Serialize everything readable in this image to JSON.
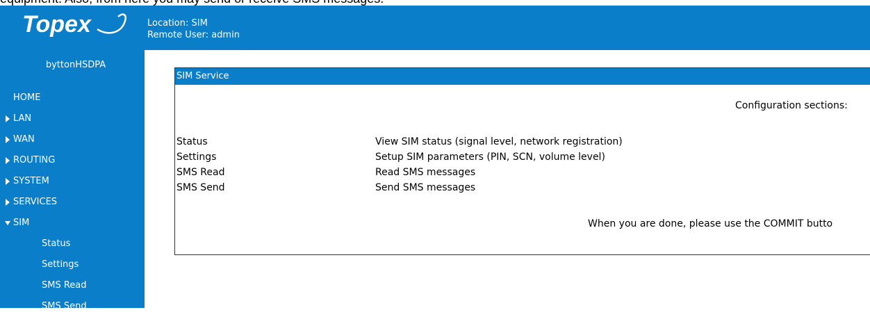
{
  "caption": "equipment. Also, from here you may send or receive SMS messages.",
  "logo_text": "Topex",
  "header": {
    "location": "Location: SIM",
    "remote_user": "Remote User: admin"
  },
  "sidebar": {
    "device": "byttonHSDPA",
    "home": "HOME",
    "items": [
      {
        "label": "LAN"
      },
      {
        "label": "WAN"
      },
      {
        "label": "ROUTING"
      },
      {
        "label": "SYSTEM"
      },
      {
        "label": "SERVICES"
      },
      {
        "label": "SIM"
      }
    ],
    "sub_items": [
      {
        "label": "Status"
      },
      {
        "label": "Settings"
      },
      {
        "label": "SMS Read"
      },
      {
        "label": "SMS Send"
      }
    ]
  },
  "panel": {
    "title": "SIM Service",
    "config_label": "Configuration sections:",
    "rows": [
      {
        "name": "Status",
        "desc": "View SIM status (signal level, network registration)"
      },
      {
        "name": "Settings",
        "desc": "Setup SIM parameters (PIN, SCN, volume level)"
      },
      {
        "name": "SMS Read",
        "desc": "Read SMS messages"
      },
      {
        "name": "SMS Send",
        "desc": "Send SMS messages"
      }
    ],
    "done_note": "When you are done, please use the COMMIT butto"
  },
  "colors": {
    "brand_blue": "#0a7ec8",
    "text_white": "#ffffff"
  },
  "icons": {
    "collapsed": "triangle-right-icon",
    "expanded": "triangle-down-icon"
  }
}
